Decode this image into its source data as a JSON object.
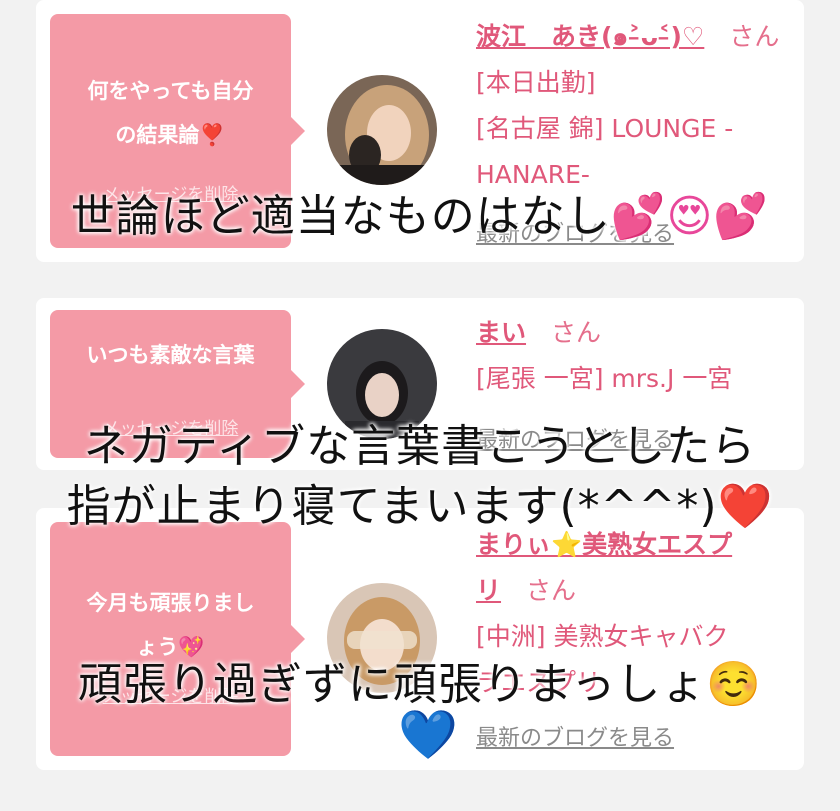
{
  "cards": [
    {
      "message": [
        "何をやっても自分",
        "の結果論❣️"
      ],
      "delete_label": "メッセージを削除",
      "name": "波江　あき(๑˃̵ᴗ˂̵)♡",
      "san": "さん",
      "status": "[本日出勤]",
      "area": [
        "[名古屋 錦] LOUNGE -",
        "HANARE-"
      ],
      "blog_label": "最新のブログを見る"
    },
    {
      "message": [
        "いつも素敵な言葉"
      ],
      "delete_label": "メッセージを削除",
      "name": "まい",
      "san": "さん",
      "area": [
        "[尾張 一宮] mrs.J 一宮"
      ],
      "blog_label": "最新のブログを見る"
    },
    {
      "message": [
        "今月も頑張りまし",
        "ょう💖"
      ],
      "delete_label": "メッセージを削除",
      "name": [
        "まりぃ⭐美熟女エスプ",
        "リ"
      ],
      "san": "さん",
      "area": [
        "[中洲] 美熟女キャバク",
        "ラエスプリ"
      ],
      "blog_label": "最新のブログを見る"
    }
  ],
  "captions": {
    "line1": "世論ほど適当なものはなし",
    "line1_emoji": "💕😍💕",
    "line2": "ネガティブな言葉書こうとしたら",
    "line3": "指が止まり寝てまいます(*^^*)",
    "line3_emoji": "❤️",
    "line4": "頑張り過ぎずに頑張りまっしょ",
    "line4_emoji": "☺️",
    "line5_emoji": "💙"
  },
  "colors": {
    "bubble": "#f49aa6",
    "name": "#e0587a",
    "link_gray": "#8a8a8a",
    "background": "#f2f2f2"
  }
}
